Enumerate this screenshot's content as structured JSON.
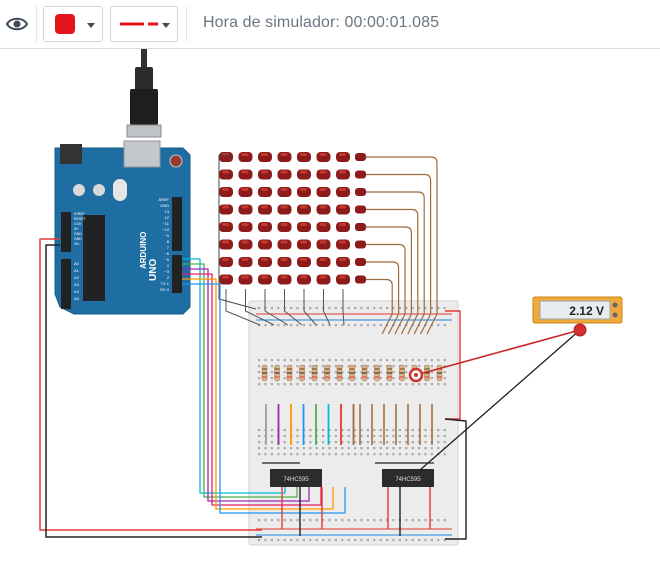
{
  "toolbar": {
    "eye_icon": "eye-icon",
    "fill_color": "#e4141b",
    "line_style_color": "#e4141b",
    "timer_label": "Hora de simulador: 00:00:01.085"
  },
  "arduino": {
    "model": "UNO",
    "brand": "ARDUINO",
    "header_labels": [
      "AREF",
      "GND",
      "13",
      "12",
      "~11",
      "~10",
      "~9",
      "8",
      "7",
      "~6",
      "~5",
      "4",
      "~3",
      "2",
      "TX 1",
      "RX 0"
    ],
    "power_labels": [
      "IOREF",
      "RESET",
      "3.3V",
      "5V",
      "GND",
      "GND",
      "Vin"
    ],
    "analog_labels": [
      "A0",
      "A1",
      "A2",
      "A3",
      "A4",
      "A5"
    ],
    "header_title": "DIGITAL (PWM~)",
    "power_title": "POWER",
    "analog_title": "ANALOG IN"
  },
  "chips": [
    {
      "label": "74HC595"
    },
    {
      "label": "74HC595"
    }
  ],
  "multimeter": {
    "reading": "2.12 V"
  },
  "wire_colors": [
    "#9c6b3f",
    "#ff9800",
    "#e53935",
    "#9c27b0",
    "#2196f3",
    "#4caf50",
    "#00bcd4",
    "#212121",
    "#e91e63"
  ]
}
